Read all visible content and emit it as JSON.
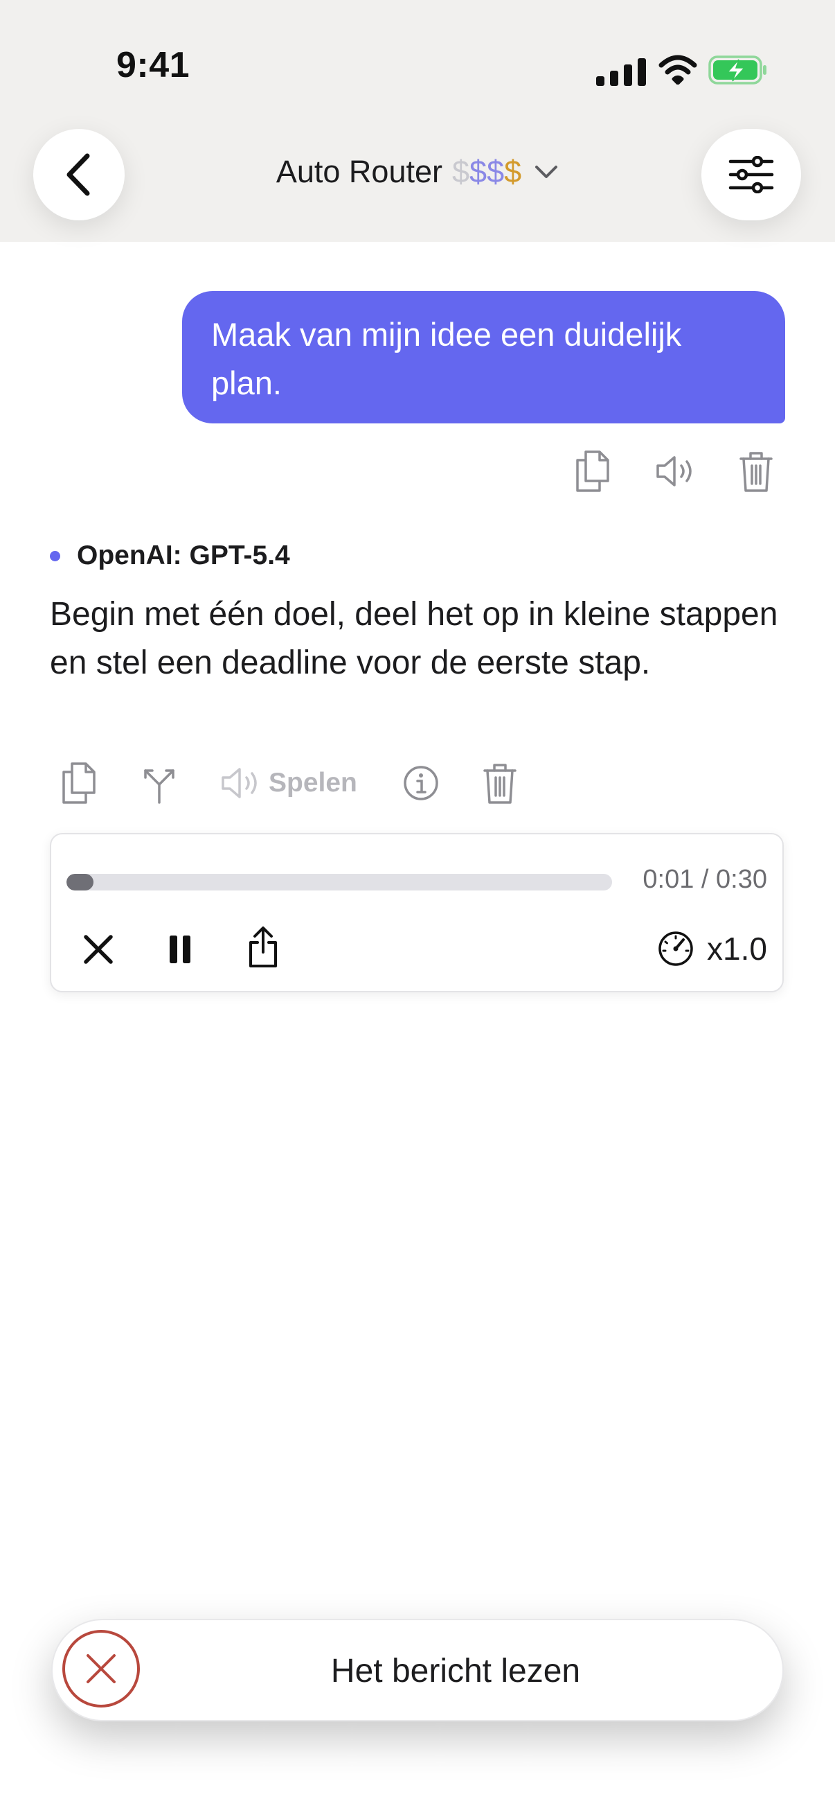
{
  "status_bar": {
    "time": "9:41"
  },
  "header": {
    "title": "Auto Router",
    "price": [
      {
        "symbol": "$",
        "color": "#c9c9cf"
      },
      {
        "symbol": "$",
        "color": "#8a88e6"
      },
      {
        "symbol": "$",
        "color": "#8a88e6"
      },
      {
        "symbol": "$",
        "color": "#d39a2c"
      }
    ],
    "icons": {
      "back": "chevron-left-icon",
      "filter": "sliders-icon",
      "dropdown": "chevron-down-icon"
    }
  },
  "user_message": {
    "text": "Maak van mijn idee een duidelijk plan.",
    "actions": [
      "copy-icon",
      "speaker-icon",
      "trash-icon"
    ],
    "bubble_color": "#6467ef"
  },
  "assistant_message": {
    "model": "OpenAI: GPT-5.4",
    "text": "Begin met één doel, deel het op in kleine stappen en stel een deadline voor de eerste stap.",
    "actions": {
      "play_label": "Spelen",
      "icons": [
        "copy-icon",
        "branch-icon",
        "speaker-icon",
        "info-icon",
        "trash-icon"
      ]
    }
  },
  "player": {
    "progress": 0.033,
    "time": "0:01 / 0:30",
    "speed": "x1.0",
    "controls": [
      "close-icon",
      "pause-icon",
      "share-icon",
      "speedometer-icon"
    ]
  },
  "toast": {
    "text": "Het bericht lezen",
    "accent_color": "#b8483d"
  }
}
